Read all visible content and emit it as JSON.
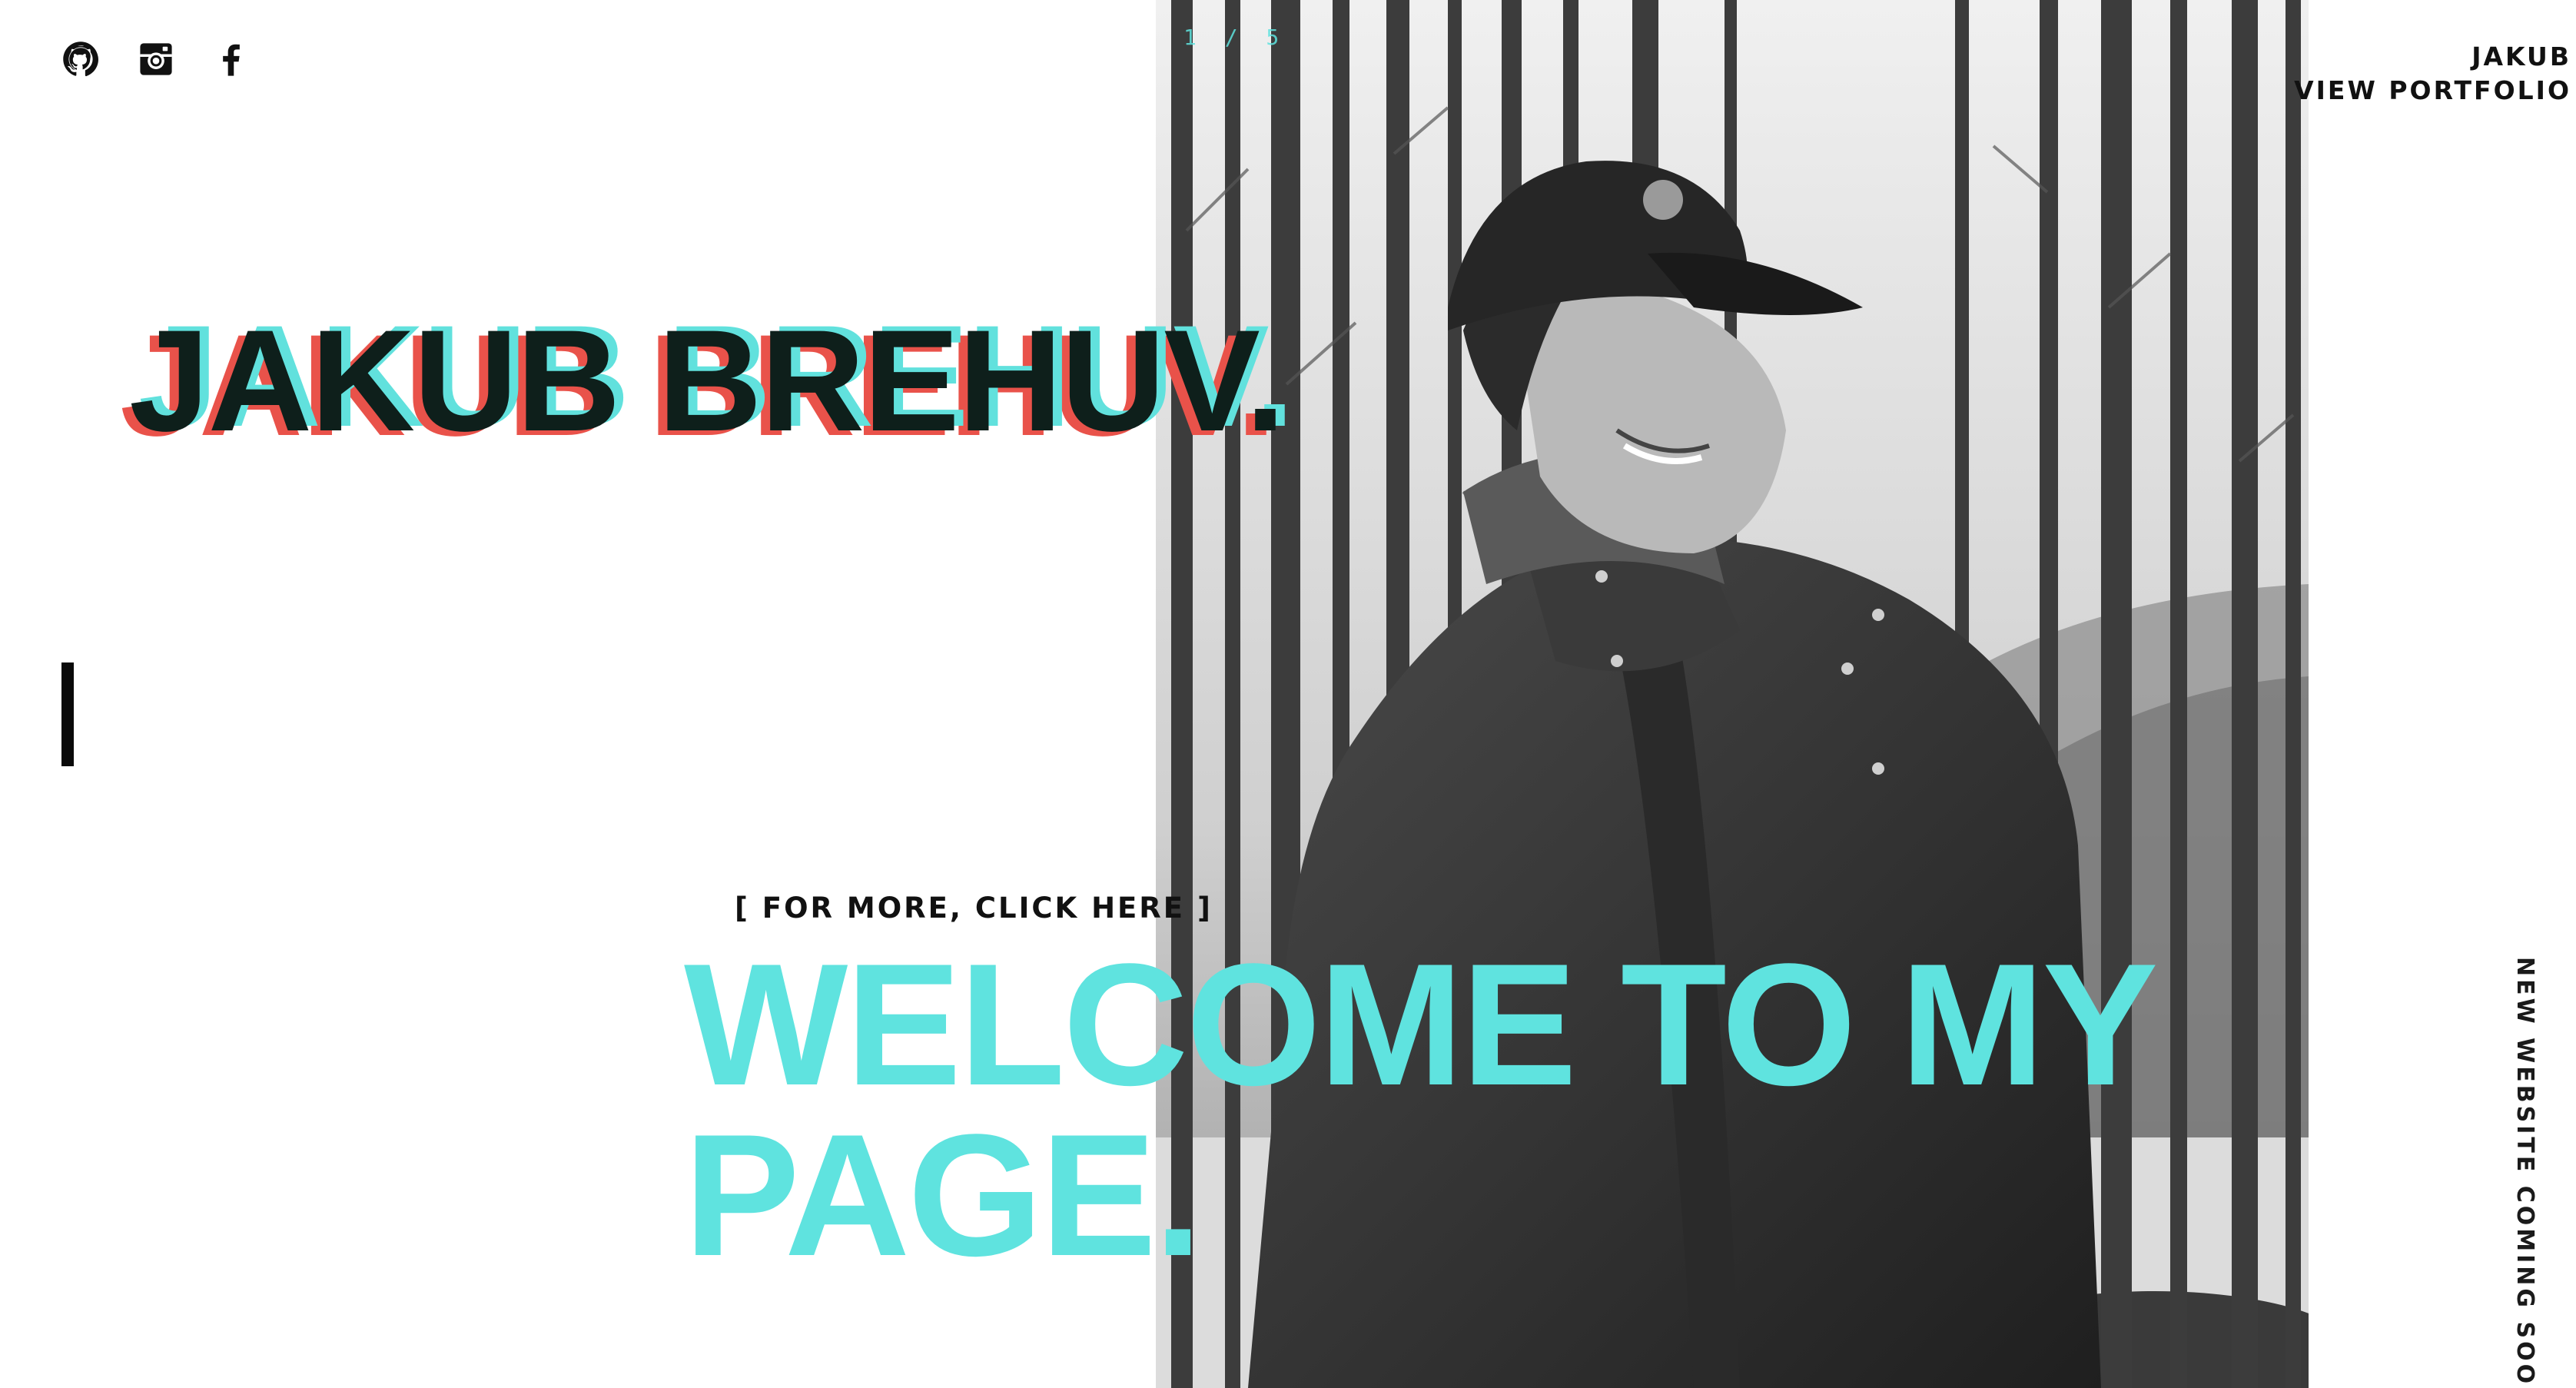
{
  "socials": [
    {
      "icon": "github-icon",
      "label": "GitHub"
    },
    {
      "icon": "instagram-icon",
      "label": "Instagram"
    },
    {
      "icon": "facebook-icon",
      "label": "Facebook"
    }
  ],
  "slide_counter": "1 / 5",
  "top_right": {
    "name": "JAKUB",
    "portfolio_link": "VIEW PORTFOLIO"
  },
  "hero": {
    "name": "JAKUB BREHUV.",
    "cta": "[ FOR MORE, CLICK HERE ]",
    "welcome_line1": "WELCOME TO MY",
    "welcome_line2": "PAGE."
  },
  "side_note": "NEW WEBSITE COMING SOON",
  "colors": {
    "accent_cyan": "#5fe3df",
    "accent_red": "#e9524a",
    "text_dark": "#111111",
    "background": "#ffffff"
  }
}
